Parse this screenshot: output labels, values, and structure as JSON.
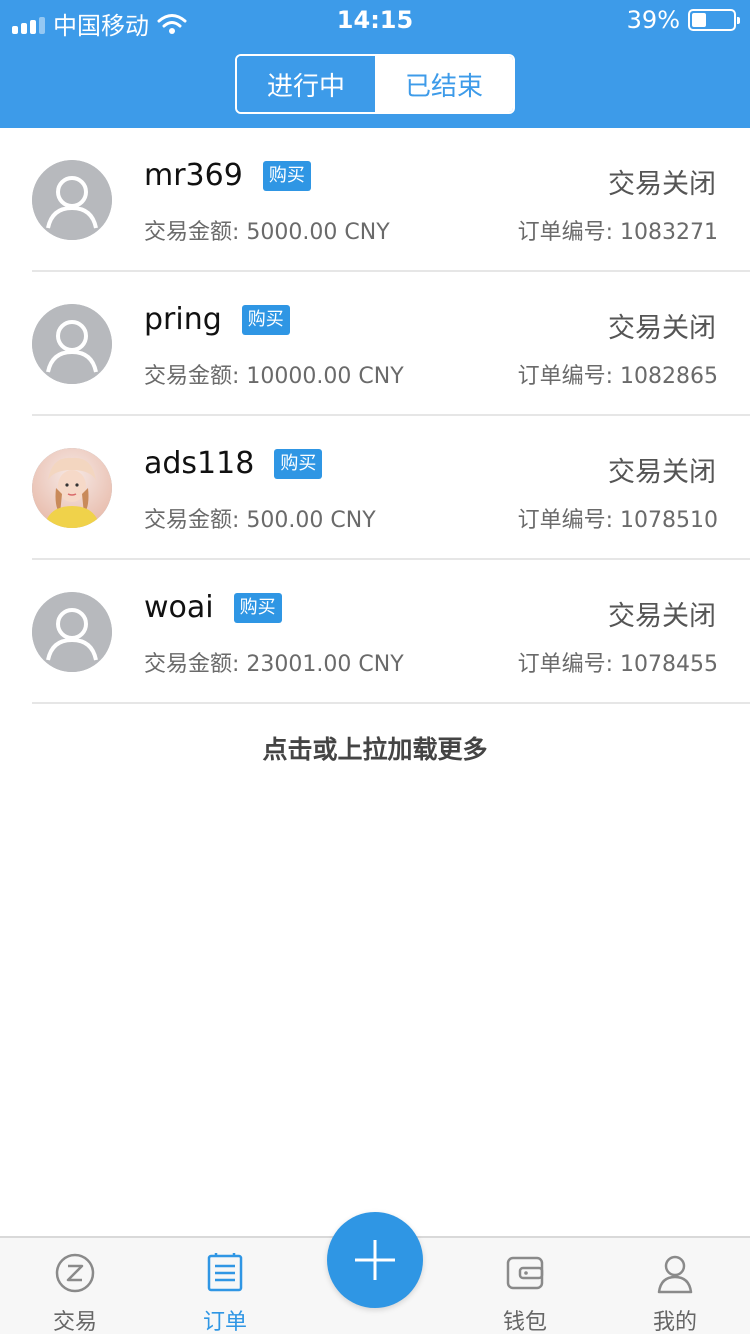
{
  "status_bar": {
    "carrier": "中国移动",
    "time": "14:15",
    "battery": "39%"
  },
  "segments": [
    {
      "label": "进行中",
      "active": true
    },
    {
      "label": "已结束",
      "active": false
    }
  ],
  "orders": [
    {
      "name": "mr369",
      "tag": "购买",
      "status": "交易关闭",
      "amount": "交易金额: 5000.00 CNY",
      "order_no": "订单编号: 1083271",
      "avatar": "default"
    },
    {
      "name": "pring",
      "tag": "购买",
      "status": "交易关闭",
      "amount": "交易金额: 10000.00 CNY",
      "order_no": "订单编号: 1082865",
      "avatar": "default"
    },
    {
      "name": "ads118",
      "tag": "购买",
      "status": "交易关闭",
      "amount": "交易金额: 500.00 CNY",
      "order_no": "订单编号: 1078510",
      "avatar": "photo"
    },
    {
      "name": "woai",
      "tag": "购买",
      "status": "交易关闭",
      "amount": "交易金额: 23001.00 CNY",
      "order_no": "订单编号: 1078455",
      "avatar": "default"
    }
  ],
  "load_more": "点击或上拉加载更多",
  "tabbar": {
    "items": [
      {
        "label": "交易",
        "icon": "trade-icon"
      },
      {
        "label": "订单",
        "icon": "order-list-icon",
        "active": true
      },
      {
        "label": "钱包",
        "icon": "wallet-icon"
      },
      {
        "label": "我的",
        "icon": "user-icon"
      }
    ],
    "fab_icon": "plus-icon"
  },
  "colors": {
    "brand": "#3d9be9",
    "tag": "#2f96e4"
  }
}
